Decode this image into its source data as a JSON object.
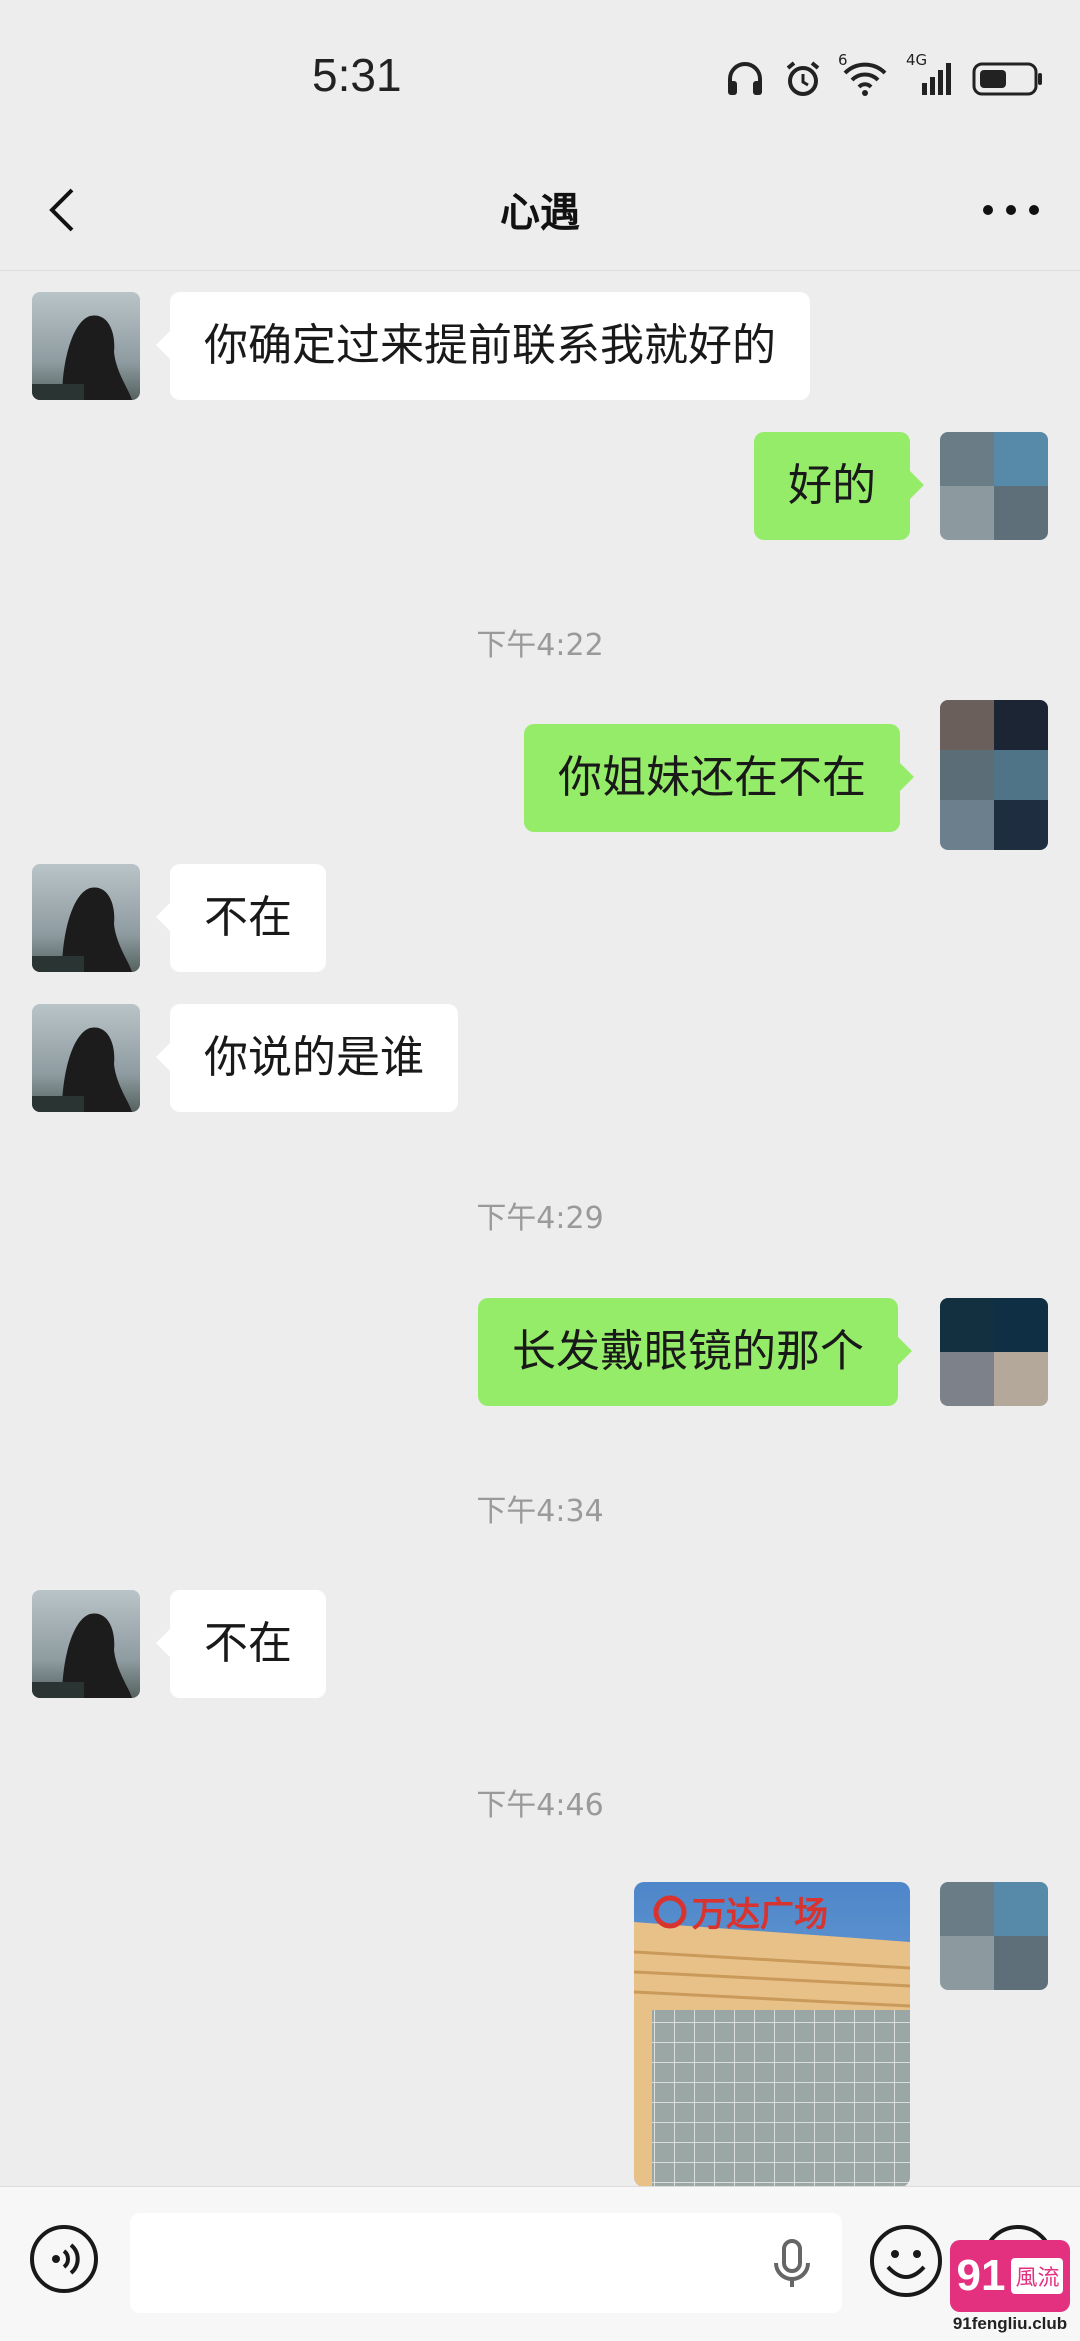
{
  "status_bar": {
    "time": "5:31",
    "icons": [
      "headphones-icon",
      "alarm-icon",
      "wifi-icon",
      "cellular-signal-icon",
      "battery-icon"
    ],
    "wifi_label": "6",
    "network_label": "4G"
  },
  "nav": {
    "title": "心遇",
    "back_icon": "chevron-left-icon",
    "more_icon": "more-dots-icon"
  },
  "messages": [
    {
      "from": "contact",
      "text": "你确定过来提前联系我就好的"
    },
    {
      "from": "me",
      "text": "好的"
    },
    {
      "type": "timestamp",
      "text": "下午4:22"
    },
    {
      "from": "me",
      "text": "你姐妹还在不在"
    },
    {
      "from": "contact",
      "text": "不在"
    },
    {
      "from": "contact",
      "text": "你说的是谁"
    },
    {
      "type": "timestamp",
      "text": "下午4:29"
    },
    {
      "from": "me",
      "text": "长发戴眼镜的那个"
    },
    {
      "type": "timestamp",
      "text": "下午4:34"
    },
    {
      "from": "contact",
      "text": "不在"
    },
    {
      "type": "timestamp",
      "text": "下午4:46"
    },
    {
      "from": "me",
      "type": "image",
      "description": "building photo",
      "sign_text": "万达广场"
    }
  ],
  "input_bar": {
    "voice_icon": "voice-input-icon",
    "mic_icon": "microphone-icon",
    "emoji_icon": "emoji-icon",
    "plus_icon": "plus-icon",
    "value": ""
  },
  "watermark": {
    "logo_number": "91",
    "logo_text": "風流",
    "domain": "91fengliu.club"
  },
  "colors": {
    "background": "#ededed",
    "outgoing_bubble": "#95ec69",
    "incoming_bubble": "#ffffff",
    "timestamp": "#9a9a9a",
    "watermark": "#e3307f"
  }
}
